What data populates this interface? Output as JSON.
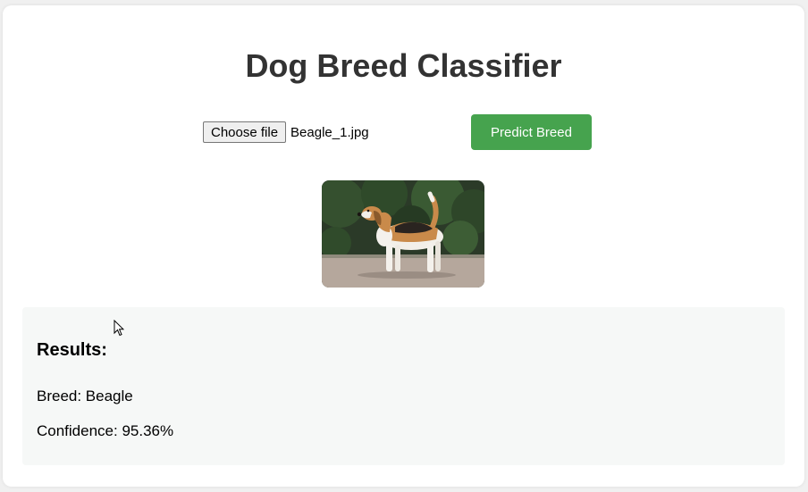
{
  "app": {
    "title": "Dog Breed Classifier"
  },
  "upload": {
    "choose_label": "Choose file",
    "file_name": "Beagle_1.jpg",
    "predict_label": "Predict Breed"
  },
  "preview": {
    "subject": "beagle standing side view"
  },
  "results": {
    "heading": "Results:",
    "breed_text": "Breed: Beagle",
    "confidence_text": "Confidence: 95.36%"
  },
  "colors": {
    "accent": "#46a34e",
    "title": "#333333",
    "results_bg": "#f6f8f7"
  },
  "icons": {
    "cursor": "mouse-pointer-icon"
  }
}
